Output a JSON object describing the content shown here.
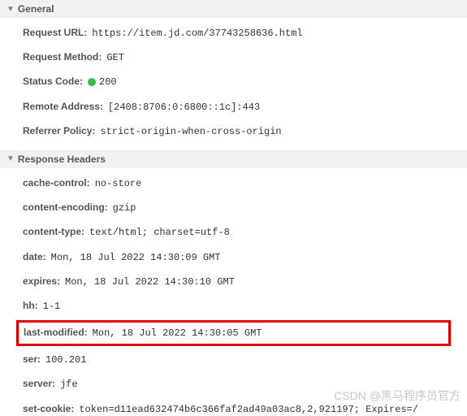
{
  "sections": {
    "general": {
      "title": "General",
      "rows": [
        {
          "label": "Request URL:",
          "value": "https://item.jd.com/37743258636.html"
        },
        {
          "label": "Request Method:",
          "value": "GET"
        },
        {
          "label": "Status Code:",
          "value": "200",
          "hasStatusDot": true
        },
        {
          "label": "Remote Address:",
          "value": "[2408:8706:0:6800::1c]:443"
        },
        {
          "label": "Referrer Policy:",
          "value": "strict-origin-when-cross-origin"
        }
      ]
    },
    "responseHeaders": {
      "title": "Response Headers",
      "rows": [
        {
          "label": "cache-control:",
          "value": "no-store"
        },
        {
          "label": "content-encoding:",
          "value": "gzip"
        },
        {
          "label": "content-type:",
          "value": "text/html; charset=utf-8"
        },
        {
          "label": "date:",
          "value": "Mon, 18 Jul 2022 14:30:09 GMT"
        },
        {
          "label": "expires:",
          "value": "Mon, 18 Jul 2022 14:30:10 GMT"
        },
        {
          "label": "hh:",
          "value": "1-1"
        },
        {
          "label": "last-modified:",
          "value": "Mon, 18 Jul 2022 14:30:05 GMT",
          "highlighted": true
        },
        {
          "label": "ser:",
          "value": "100.201"
        },
        {
          "label": "server:",
          "value": "jfe"
        },
        {
          "label": "set-cookie:",
          "value": "token=d11ead632474b6c366faf2ad49a03ac8,2,921197; Expires=/"
        }
      ]
    }
  },
  "watermark": "CSDN @黑马程序员官方"
}
